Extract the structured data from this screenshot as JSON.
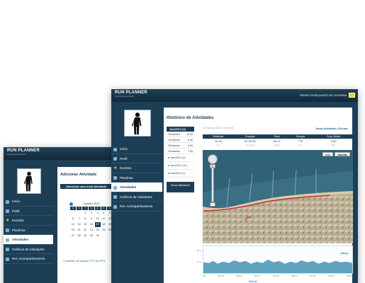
{
  "back": {
    "logo": "RUN PLANNER",
    "logo_tag": "treinos & eventos",
    "menu": [
      {
        "label": "Início",
        "icon": "home-icon"
      },
      {
        "label": "Perfil",
        "icon": "profile-icon"
      },
      {
        "label": "Eventos",
        "icon": "star-icon"
      },
      {
        "label": "Planilhas",
        "icon": "sheet-icon"
      },
      {
        "label": "Atividades",
        "icon": "activity-icon"
      },
      {
        "label": "Gráficos de Atividades",
        "icon": "chart-icon"
      },
      {
        "label": "Rel. Acompanhamento",
        "icon": "report-icon"
      }
    ],
    "selected_menu": 4,
    "page_title": "Adicionar Atividade",
    "add_bar": "Adicionar uma nova Atividade",
    "calendar": {
      "month": "Janeiro 2012",
      "weekdays": [
        "D",
        "S",
        "T",
        "Q",
        "Q",
        "S",
        "S"
      ],
      "days": [
        "1",
        "2",
        "3",
        "4",
        "5",
        "6",
        "7",
        "8",
        "9",
        "10",
        "11",
        "12",
        "13",
        "14",
        "15",
        "16",
        "17",
        "18",
        "19",
        "20",
        "21",
        "22",
        "23",
        "24",
        "25",
        "26",
        "27",
        "28",
        "29",
        "30",
        "31"
      ],
      "today": "17"
    },
    "import_link": "Importar um arquivo TCX ou GPX"
  },
  "front": {
    "logo": "RUN PLANNER",
    "logo_tag": "treinos & eventos",
    "user": "PEDRO GONÇALVES DE OLIVEIRA",
    "menu": [
      {
        "label": "Início",
        "icon": "home-icon"
      },
      {
        "label": "Perfil",
        "icon": "profile-icon"
      },
      {
        "label": "Eventos",
        "icon": "star-icon"
      },
      {
        "label": "Planilhas",
        "icon": "sheet-icon"
      },
      {
        "label": "Atividades",
        "icon": "activity-icon"
      },
      {
        "label": "Gráficos de Atividades",
        "icon": "chart-icon"
      },
      {
        "label": "Rel. Acompanhamento",
        "icon": "report-icon"
      }
    ],
    "selected_menu": 4,
    "page_title": "Histórico de Atividades",
    "breadcrumb": "15 Janeiro 2012 | 19:30h01",
    "top_links": "Nova Atividade | Excluir",
    "month_head": "Jan/2012 (4)",
    "day_items": [
      {
        "date": "15/Janeiro",
        "value": "10.00"
      },
      {
        "date": "15/Janeiro",
        "value": "8.00"
      },
      {
        "date": "15/Janeiro",
        "value": "8.00"
      },
      {
        "date": "10/Janeiro",
        "value": "7.00"
      }
    ],
    "other_months": [
      "Dez/2011 (3)",
      "Nov/2011 (10)",
      "Out/2011 (1)"
    ],
    "new_activity_button": "Nova Atividade",
    "stats": {
      "headers": [
        "Distância",
        "Duração",
        "Pace",
        "Energia",
        "Freq. Média"
      ],
      "values": [
        "10.00",
        "01:32:34",
        "06:12",
        "770",
        "0.00"
      ],
      "units": [
        "Km",
        "hh:mm:ss",
        "min/km",
        "kcal",
        "bpm"
      ]
    },
    "map_buttons": {
      "map": "Map",
      "satellite": "Satellite"
    },
    "elevation": {
      "legend": "Altitude",
      "y_ticks": [
        "20 m",
        "10 m"
      ],
      "x_ticks": [
        "0.0",
        "1357.5",
        "2035.0",
        "3071.7",
        "3303.6",
        "4694.3",
        "5479.0",
        "7063.0",
        "7996.9"
      ]
    },
    "change_link": "Alterar"
  }
}
